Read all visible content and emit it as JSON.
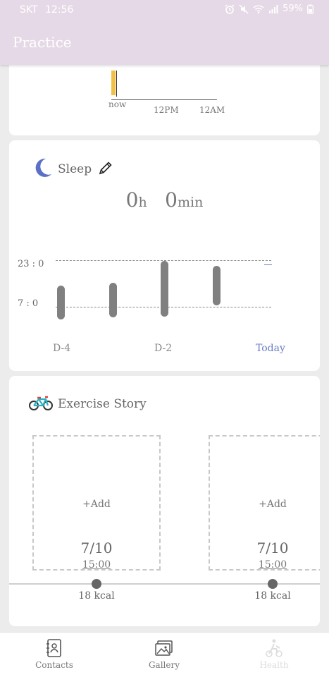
{
  "status_bar": {
    "carrier": "SKT",
    "time": "12:56",
    "battery": "59%"
  },
  "app_bar": {
    "title": "Practice"
  },
  "timeline": {
    "labels": [
      "now",
      "12PM",
      "12AM"
    ]
  },
  "sleep": {
    "title": "Sleep",
    "hours_value": "0",
    "hours_unit": "h",
    "minutes_value": "0",
    "minutes_unit": "min",
    "y_labels": [
      "23 : 0",
      "7 : 0"
    ],
    "x_labels": [
      "D-4",
      "D-2",
      "Today"
    ],
    "colors": {
      "today": "#6a7dc4",
      "bar": "#808080",
      "moon": "#5b6fc7"
    }
  },
  "exercise": {
    "title": "Exercise Story",
    "cards": [
      {
        "add_label": "+Add",
        "date": "7/10",
        "time": "15:00",
        "kcal": "18 kcal"
      },
      {
        "add_label": "+Add",
        "date": "7/10",
        "time": "15:00",
        "kcal": "18 kcal"
      }
    ]
  },
  "bottom_nav": {
    "items": [
      {
        "label": "Contacts",
        "icon": "contacts-icon"
      },
      {
        "label": "Gallery",
        "icon": "gallery-icon"
      },
      {
        "label": "Health",
        "icon": "health-icon"
      }
    ]
  },
  "theme": {
    "header": "#e6d9e7",
    "timeline_bar": "#f0c144",
    "background": "#ececec"
  }
}
